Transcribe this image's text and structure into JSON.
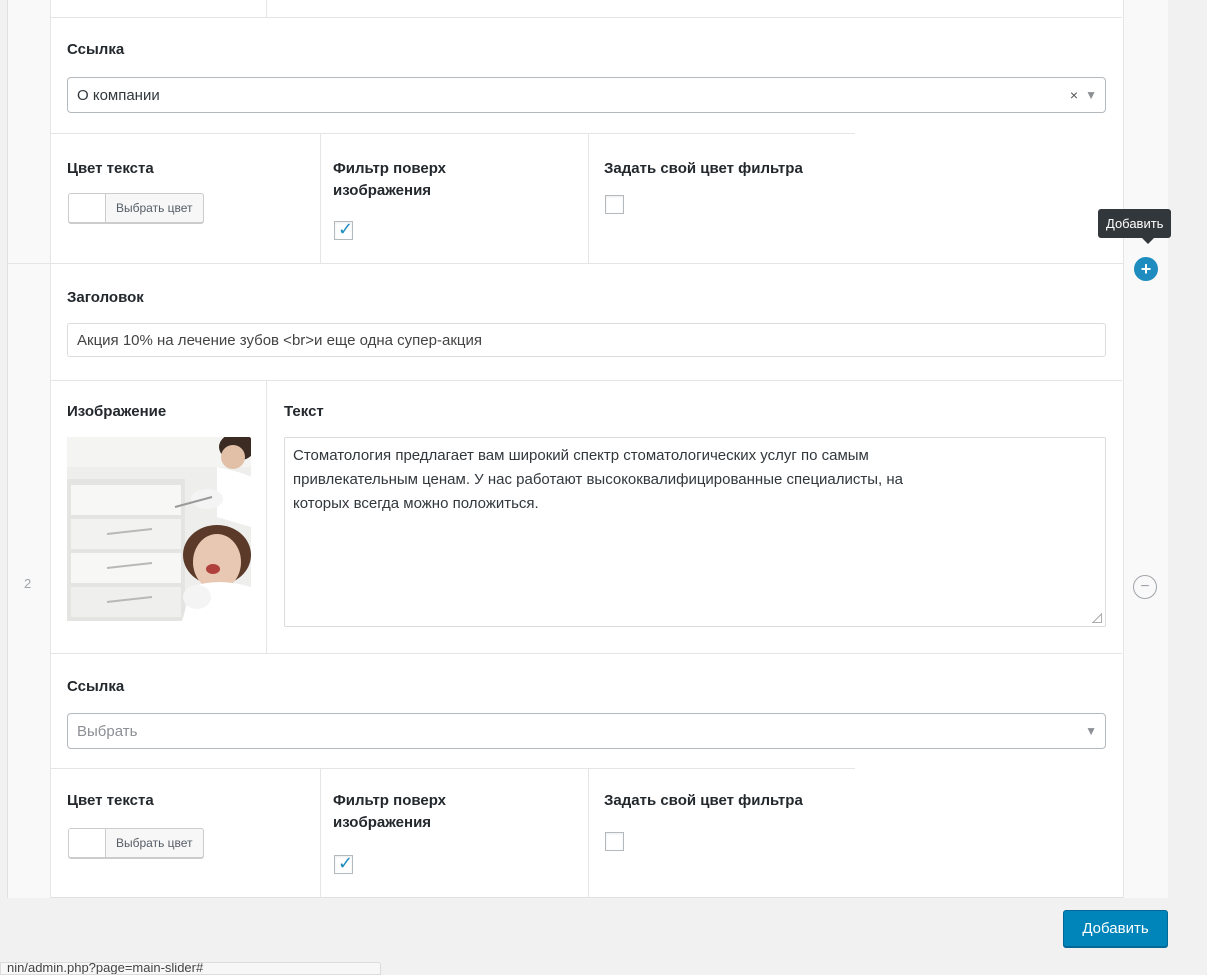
{
  "row1": {
    "link": {
      "label": "Ссылка",
      "value": "О компании",
      "clear_glyph": "×",
      "arrow_glyph": "▼"
    },
    "text_color": {
      "label": "Цвет текста",
      "button": "Выбрать цвет"
    },
    "filter_overlay": {
      "label_line1": "Фильтр поверх",
      "label_line2": "изображения",
      "checked": true
    },
    "custom_filter_color": {
      "label": "Задать свой цвет фильтра",
      "checked": false
    }
  },
  "row2": {
    "row_number": "2",
    "heading": {
      "label": "Заголовок",
      "value": "Акция 10% на лечение зубов <br>и еще одна супер-акция"
    },
    "image": {
      "label": "Изображение"
    },
    "text": {
      "label": "Текст",
      "line1": "Стоматология предлагает вам широкий спектр стоматологических услуг по самым",
      "line2": "привлекательным ценам. У нас работают высококвалифицированные специалисты, на",
      "line3": "которых всегда можно положиться."
    },
    "link": {
      "label": "Ссылка",
      "placeholder": "Выбрать",
      "arrow_glyph": "▼"
    },
    "text_color": {
      "label": "Цвет текста",
      "button": "Выбрать цвет"
    },
    "filter_overlay": {
      "label_line1": "Фильтр поверх",
      "label_line2": "изображения",
      "checked": true
    },
    "custom_filter_color": {
      "label": "Задать свой цвет фильтра",
      "checked": false
    }
  },
  "actions": {
    "tooltip": "Добавить",
    "add_row_glyph": "+",
    "remove_row_glyph": "−",
    "add_button": "Добавить",
    "checkmark": "✓"
  },
  "status_bar": {
    "url": "nin/admin.php?page=main-slider#"
  },
  "colors": {
    "accent": "#0085ba",
    "check": "#1e8cbe",
    "background": "#f1f1f1",
    "tooltip_bg": "#32373c"
  },
  "icons": [
    "plus-circle-icon",
    "minus-circle-icon",
    "dropdown-arrow-icon",
    "clear-icon",
    "checkmark-icon",
    "resize-handle-icon"
  ]
}
